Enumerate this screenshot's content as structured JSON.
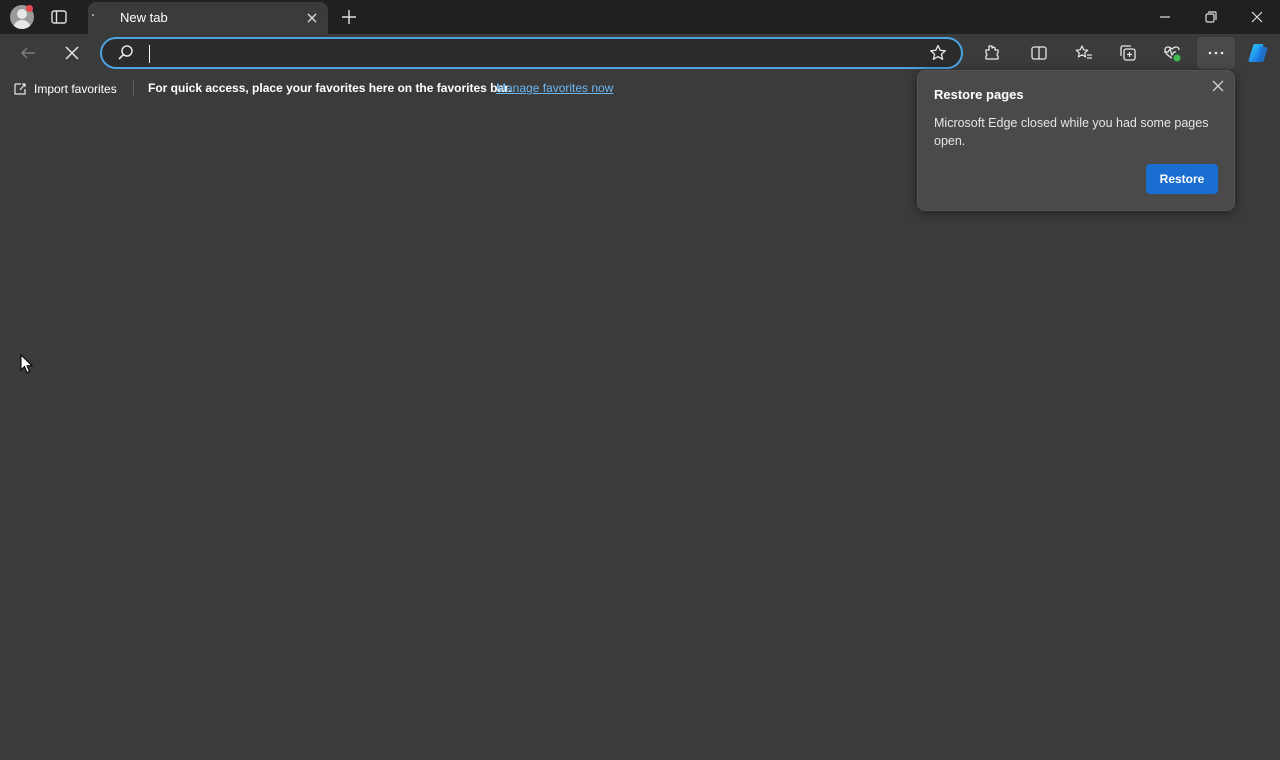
{
  "tab": {
    "title": "New tab"
  },
  "address_bar": {
    "value": "",
    "placeholder": ""
  },
  "favorites_bar": {
    "import_label": "Import favorites",
    "message": "For quick access, place your favorites here on the favorites bar.",
    "manage_link": "Manage favorites now"
  },
  "popup": {
    "title": "Restore pages",
    "text": "Microsoft Edge closed while you had some pages open.",
    "button": "Restore"
  },
  "colors": {
    "accent": "#1a6dd1",
    "link": "#6cb6f3",
    "background": "#3b3b3b",
    "titlebar": "#202020"
  },
  "icons": [
    "profile-avatar",
    "tab-actions-icon",
    "close-icon",
    "plus-icon",
    "minimize-icon",
    "restore-window-icon",
    "back-arrow-icon",
    "stop-loading-icon",
    "search-icon",
    "favorite-star-icon",
    "extensions-icon",
    "split-screen-icon",
    "favorites-icon",
    "collections-icon",
    "browser-essentials-icon",
    "more-options-icon",
    "copilot-icon",
    "import-favorites-icon"
  ]
}
